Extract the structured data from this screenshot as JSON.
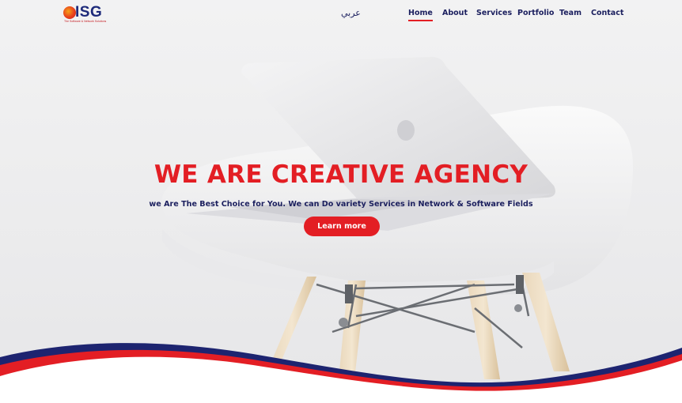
{
  "brand": {
    "name": "ISG",
    "tagline": "The Software & Network Solutions"
  },
  "nav": {
    "language_toggle": "عربي",
    "items": [
      {
        "label": "Home",
        "active": true
      },
      {
        "label": "About",
        "active": false
      },
      {
        "label": "Services",
        "active": false
      },
      {
        "label": "Portfolio",
        "active": false
      },
      {
        "label": "Team",
        "active": false
      },
      {
        "label": "Contact",
        "active": false
      }
    ]
  },
  "hero": {
    "title": "WE ARE CREATIVE AGENCY",
    "subtitle": "we Are The Best Choice for You. We can Do variety Services in Network & Software Fields",
    "cta_label": "Learn more"
  },
  "colors": {
    "accent_red": "#e31e24",
    "navy": "#1b1f5e"
  }
}
